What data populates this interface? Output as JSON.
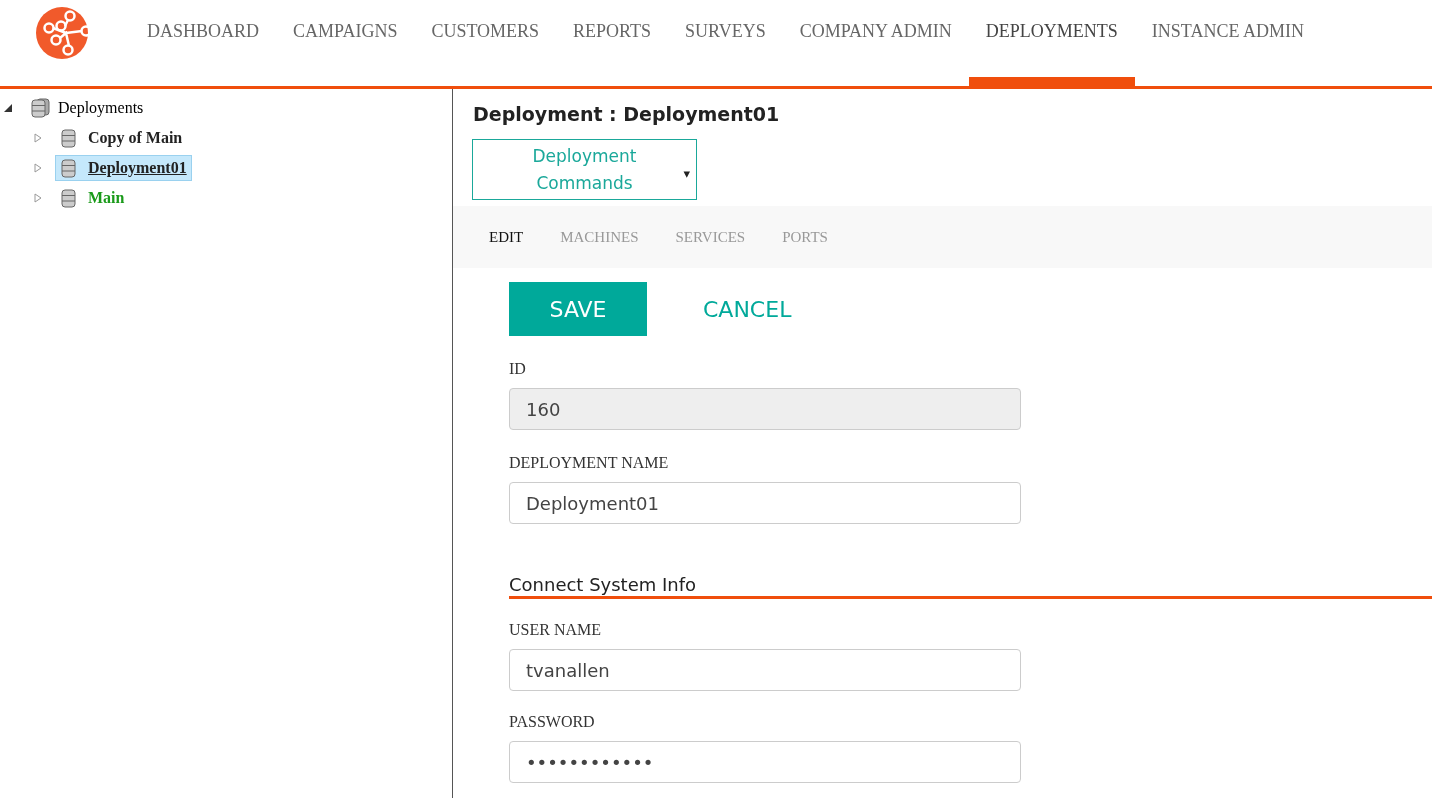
{
  "nav": {
    "items": [
      {
        "label": "DASHBOARD",
        "selected": false
      },
      {
        "label": "CAMPAIGNS",
        "selected": false
      },
      {
        "label": "CUSTOMERS",
        "selected": false
      },
      {
        "label": "REPORTS",
        "selected": false
      },
      {
        "label": "SURVEYS",
        "selected": false
      },
      {
        "label": "COMPANY ADMIN",
        "selected": false
      },
      {
        "label": "DEPLOYMENTS",
        "selected": true
      },
      {
        "label": "INSTANCE ADMIN",
        "selected": false
      }
    ]
  },
  "tree": {
    "label": "Deployments",
    "expanded": true,
    "children": [
      {
        "label": "Copy of Main",
        "selected": false,
        "expanded": false,
        "color": "#222222"
      },
      {
        "label": "Deployment01",
        "selected": true,
        "expanded": false,
        "color": "#222222"
      },
      {
        "label": "Main",
        "selected": false,
        "expanded": false,
        "color": "#1a9a1a"
      }
    ]
  },
  "detail": {
    "title": "Deployment : Deployment01",
    "commands_button": "Deployment Commands",
    "caret": "▾",
    "tabs": [
      {
        "label": "EDIT",
        "selected": true
      },
      {
        "label": "MACHINES",
        "selected": false
      },
      {
        "label": "SERVICES",
        "selected": false
      },
      {
        "label": "PORTS",
        "selected": false
      }
    ],
    "save": "SAVE",
    "cancel": "CANCEL",
    "fields": [
      {
        "label": "ID",
        "value": "160",
        "disabled": true
      },
      {
        "label": "DEPLOYMENT NAME",
        "value": "Deployment01",
        "disabled": false
      }
    ],
    "section_title": "Connect System Info",
    "section_fields": [
      {
        "label": "USER NAME",
        "value": "tvanallen",
        "disabled": false
      },
      {
        "label": "PASSWORD",
        "value": "••••••••••••",
        "disabled": false
      }
    ]
  }
}
